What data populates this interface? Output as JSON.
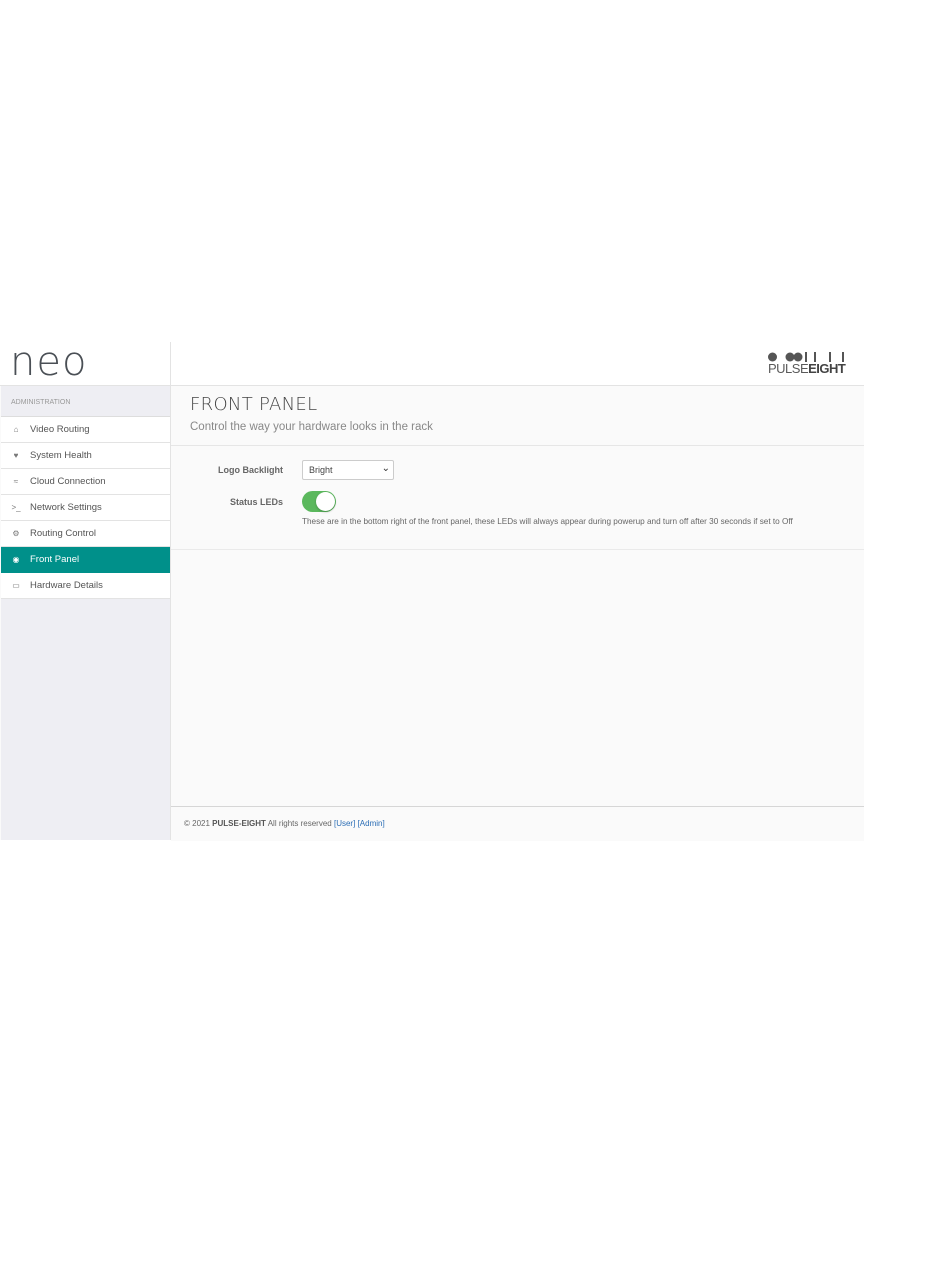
{
  "brand": {
    "app_logo": "neo",
    "company_logo_light": "PULSE",
    "company_logo_bold": "EIGHT"
  },
  "sidebar": {
    "section_header": "ADMINISTRATION",
    "items": [
      {
        "label": "Video Routing",
        "icon": "home-icon",
        "glyph": "⌂",
        "active": false
      },
      {
        "label": "System Health",
        "icon": "heart-icon",
        "glyph": "♥",
        "active": false
      },
      {
        "label": "Cloud Connection",
        "icon": "rss-icon",
        "glyph": "≈",
        "active": false
      },
      {
        "label": "Network Settings",
        "icon": "terminal-icon",
        "glyph": ">_",
        "active": false
      },
      {
        "label": "Routing Control",
        "icon": "cogs-icon",
        "glyph": "⚙",
        "active": false
      },
      {
        "label": "Front Panel",
        "icon": "dashboard-icon",
        "glyph": "◉",
        "active": true
      },
      {
        "label": "Hardware Details",
        "icon": "hdd-icon",
        "glyph": "▭",
        "active": false
      }
    ]
  },
  "page": {
    "title": "FRONT PANEL",
    "subtitle": "Control the way your hardware looks in the rack"
  },
  "form": {
    "logo_backlight_label": "Logo Backlight",
    "logo_backlight_value": "Bright",
    "status_leds_label": "Status LEDs",
    "status_leds_on": true,
    "status_leds_help": "These are in the bottom right of the front panel, these LEDs will always appear during powerup and turn off after 30 seconds if set to Off"
  },
  "footer": {
    "copyright": "© 2021",
    "company": "PULSE-EIGHT",
    "rights": "All rights reserved",
    "link_user": "[User]",
    "link_admin": "[Admin]"
  },
  "colors": {
    "accent": "#00908a",
    "toggle_on": "#5bb85d",
    "link": "#2a6db5"
  }
}
